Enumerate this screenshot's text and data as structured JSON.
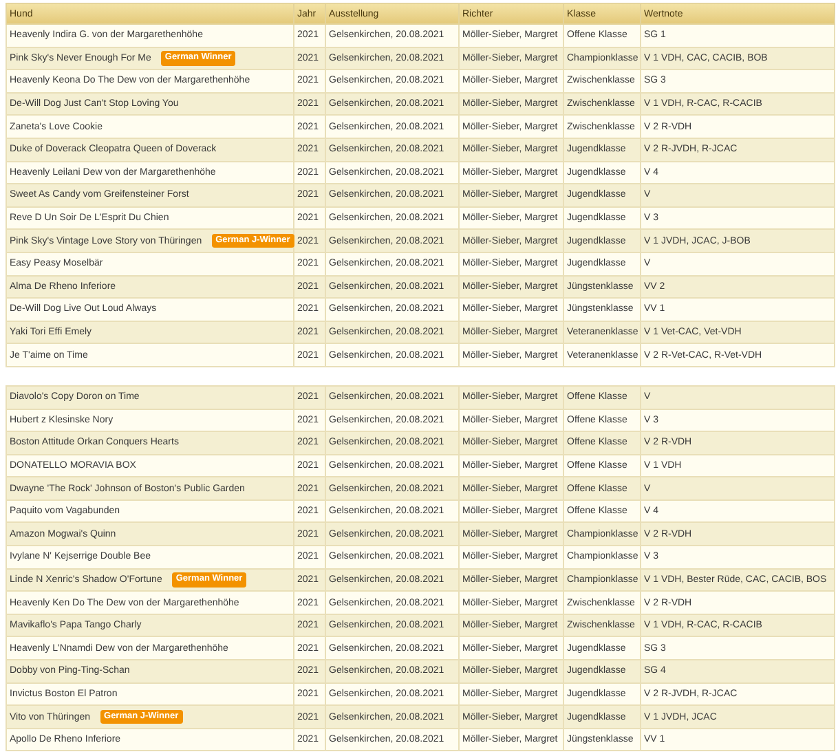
{
  "columns": [
    "Hund",
    "Jahr",
    "Ausstellung",
    "Richter",
    "Klasse",
    "Wertnote"
  ],
  "tables": [
    {
      "rows": [
        {
          "hund": "Heavenly Indira G. von der Margarethenhöhe",
          "jahr": "2021",
          "ausstellung": "Gelsenkirchen, 20.08.2021",
          "richter": "Möller-Sieber, Margret",
          "klasse": "Offene Klasse",
          "wertnote": "SG 1"
        },
        {
          "hund": "Pink Sky's Never Enough For Me",
          "badge": "German Winner",
          "jahr": "2021",
          "ausstellung": "Gelsenkirchen, 20.08.2021",
          "richter": "Möller-Sieber, Margret",
          "klasse": "Championklasse",
          "wertnote": "V 1 VDH, CAC, CACIB, BOB"
        },
        {
          "hund": "Heavenly Keona Do The Dew von der Margarethenhöhe",
          "jahr": "2021",
          "ausstellung": "Gelsenkirchen, 20.08.2021",
          "richter": "Möller-Sieber, Margret",
          "klasse": "Zwischenklasse",
          "wertnote": "SG 3"
        },
        {
          "hund": "De-Will Dog Just Can't Stop Loving You",
          "jahr": "2021",
          "ausstellung": "Gelsenkirchen, 20.08.2021",
          "richter": "Möller-Sieber, Margret",
          "klasse": "Zwischenklasse",
          "wertnote": "V 1 VDH, R-CAC, R-CACIB"
        },
        {
          "hund": "Zaneta's Love Cookie",
          "jahr": "2021",
          "ausstellung": "Gelsenkirchen, 20.08.2021",
          "richter": "Möller-Sieber, Margret",
          "klasse": "Zwischenklasse",
          "wertnote": "V 2 R-VDH"
        },
        {
          "hund": "Duke of Doverack Cleopatra Queen of Doverack",
          "jahr": "2021",
          "ausstellung": "Gelsenkirchen, 20.08.2021",
          "richter": "Möller-Sieber, Margret",
          "klasse": "Jugendklasse",
          "wertnote": "V 2 R-JVDH, R-JCAC"
        },
        {
          "hund": "Heavenly Leilani Dew von der Margarethenhöhe",
          "jahr": "2021",
          "ausstellung": "Gelsenkirchen, 20.08.2021",
          "richter": "Möller-Sieber, Margret",
          "klasse": "Jugendklasse",
          "wertnote": "V 4"
        },
        {
          "hund": "Sweet As Candy vom Greifensteiner Forst",
          "jahr": "2021",
          "ausstellung": "Gelsenkirchen, 20.08.2021",
          "richter": "Möller-Sieber, Margret",
          "klasse": "Jugendklasse",
          "wertnote": "V"
        },
        {
          "hund": "Reve D Un Soir De L'Esprit Du Chien",
          "jahr": "2021",
          "ausstellung": "Gelsenkirchen, 20.08.2021",
          "richter": "Möller-Sieber, Margret",
          "klasse": "Jugendklasse",
          "wertnote": "V 3"
        },
        {
          "hund": "Pink Sky's Vintage Love Story von Thüringen",
          "badge": "German J-Winner",
          "jahr": "2021",
          "ausstellung": "Gelsenkirchen, 20.08.2021",
          "richter": "Möller-Sieber, Margret",
          "klasse": "Jugendklasse",
          "wertnote": "V 1 JVDH, JCAC, J-BOB"
        },
        {
          "hund": "Easy Peasy Moselbär",
          "jahr": "2021",
          "ausstellung": "Gelsenkirchen, 20.08.2021",
          "richter": "Möller-Sieber, Margret",
          "klasse": "Jugendklasse",
          "wertnote": "V"
        },
        {
          "hund": "Alma De Rheno Inferiore",
          "jahr": "2021",
          "ausstellung": "Gelsenkirchen, 20.08.2021",
          "richter": "Möller-Sieber, Margret",
          "klasse": "Jüngstenklasse",
          "wertnote": "VV 2"
        },
        {
          "hund": "De-Will Dog Live Out Loud Always",
          "jahr": "2021",
          "ausstellung": "Gelsenkirchen, 20.08.2021",
          "richter": "Möller-Sieber, Margret",
          "klasse": "Jüngstenklasse",
          "wertnote": "VV 1"
        },
        {
          "hund": "Yaki Tori Effi Emely",
          "jahr": "2021",
          "ausstellung": "Gelsenkirchen, 20.08.2021",
          "richter": "Möller-Sieber, Margret",
          "klasse": "Veteranenklasse",
          "wertnote": "V 1 Vet-CAC, Vet-VDH"
        },
        {
          "hund": "Je T'aime on Time",
          "jahr": "2021",
          "ausstellung": "Gelsenkirchen, 20.08.2021",
          "richter": "Möller-Sieber, Margret",
          "klasse": "Veteranenklasse",
          "wertnote": "V 2 R-Vet-CAC, R-Vet-VDH"
        }
      ]
    },
    {
      "rows": [
        {
          "hund": "Diavolo's Copy Doron on Time",
          "jahr": "2021",
          "ausstellung": "Gelsenkirchen, 20.08.2021",
          "richter": "Möller-Sieber, Margret",
          "klasse": "Offene Klasse",
          "wertnote": "V"
        },
        {
          "hund": "Hubert z Klesinske Nory",
          "jahr": "2021",
          "ausstellung": "Gelsenkirchen, 20.08.2021",
          "richter": "Möller-Sieber, Margret",
          "klasse": "Offene Klasse",
          "wertnote": "V 3"
        },
        {
          "hund": "Boston Attitude Orkan Conquers Hearts",
          "jahr": "2021",
          "ausstellung": "Gelsenkirchen, 20.08.2021",
          "richter": "Möller-Sieber, Margret",
          "klasse": "Offene Klasse",
          "wertnote": "V 2 R-VDH"
        },
        {
          "hund": "DONATELLO MORAVIA BOX",
          "jahr": "2021",
          "ausstellung": "Gelsenkirchen, 20.08.2021",
          "richter": "Möller-Sieber, Margret",
          "klasse": "Offene Klasse",
          "wertnote": "V 1 VDH"
        },
        {
          "hund": "Dwayne 'The Rock' Johnson of Boston's Public Garden",
          "jahr": "2021",
          "ausstellung": "Gelsenkirchen, 20.08.2021",
          "richter": "Möller-Sieber, Margret",
          "klasse": "Offene Klasse",
          "wertnote": "V"
        },
        {
          "hund": "Paquito vom Vagabunden",
          "jahr": "2021",
          "ausstellung": "Gelsenkirchen, 20.08.2021",
          "richter": "Möller-Sieber, Margret",
          "klasse": "Offene Klasse",
          "wertnote": "V 4"
        },
        {
          "hund": "Amazon Mogwai's Quinn",
          "jahr": "2021",
          "ausstellung": "Gelsenkirchen, 20.08.2021",
          "richter": "Möller-Sieber, Margret",
          "klasse": "Championklasse",
          "wertnote": "V 2 R-VDH"
        },
        {
          "hund": "Ivylane N' Kejserrige Double Bee",
          "jahr": "2021",
          "ausstellung": "Gelsenkirchen, 20.08.2021",
          "richter": "Möller-Sieber, Margret",
          "klasse": "Championklasse",
          "wertnote": "V 3"
        },
        {
          "hund": "Linde N Xenric's Shadow O'Fortune",
          "badge": "German Winner",
          "jahr": "2021",
          "ausstellung": "Gelsenkirchen, 20.08.2021",
          "richter": "Möller-Sieber, Margret",
          "klasse": "Championklasse",
          "wertnote": "V 1 VDH, Bester Rüde, CAC, CACIB, BOS"
        },
        {
          "hund": "Heavenly Ken Do The Dew von der Margarethenhöhe",
          "jahr": "2021",
          "ausstellung": "Gelsenkirchen, 20.08.2021",
          "richter": "Möller-Sieber, Margret",
          "klasse": "Zwischenklasse",
          "wertnote": "V 2 R-VDH"
        },
        {
          "hund": "Mavikaflo's Papa Tango Charly",
          "jahr": "2021",
          "ausstellung": "Gelsenkirchen, 20.08.2021",
          "richter": "Möller-Sieber, Margret",
          "klasse": "Zwischenklasse",
          "wertnote": "V 1 VDH, R-CAC, R-CACIB"
        },
        {
          "hund": "Heavenly L'Nnamdi Dew von der Margarethenhöhe",
          "jahr": "2021",
          "ausstellung": "Gelsenkirchen, 20.08.2021",
          "richter": "Möller-Sieber, Margret",
          "klasse": "Jugendklasse",
          "wertnote": "SG 3"
        },
        {
          "hund": "Dobby von Ping-Ting-Schan",
          "jahr": "2021",
          "ausstellung": "Gelsenkirchen, 20.08.2021",
          "richter": "Möller-Sieber, Margret",
          "klasse": "Jugendklasse",
          "wertnote": "SG 4"
        },
        {
          "hund": "Invictus Boston El Patron",
          "jahr": "2021",
          "ausstellung": "Gelsenkirchen, 20.08.2021",
          "richter": "Möller-Sieber, Margret",
          "klasse": "Jugendklasse",
          "wertnote": "V 2 R-JVDH, R-JCAC"
        },
        {
          "hund": "Vito von Thüringen",
          "badge": "German J-Winner",
          "jahr": "2021",
          "ausstellung": "Gelsenkirchen, 20.08.2021",
          "richter": "Möller-Sieber, Margret",
          "klasse": "Jugendklasse",
          "wertnote": "V 1 JVDH, JCAC"
        },
        {
          "hund": "Apollo De Rheno Inferiore",
          "jahr": "2021",
          "ausstellung": "Gelsenkirchen, 20.08.2021",
          "richter": "Möller-Sieber, Margret",
          "klasse": "Jüngstenklasse",
          "wertnote": "VV 1"
        }
      ]
    }
  ]
}
